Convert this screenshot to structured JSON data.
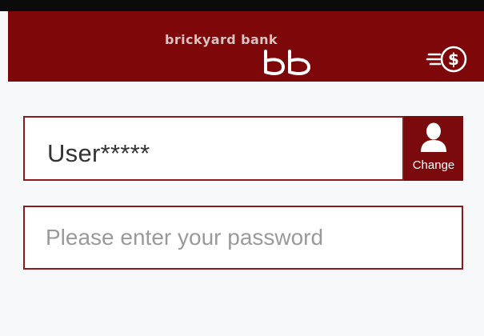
{
  "app": {
    "brand_name": "brickyard bank"
  },
  "header": {
    "logo_text": "brickyard bank",
    "logo_icon": "bb-logo-icon",
    "menu_icon": "money-menu-icon"
  },
  "login": {
    "username": "User*****",
    "change_label": "Change",
    "change_icon": "user-icon",
    "password_placeholder": "Please enter your password",
    "password_value": ""
  },
  "colors": {
    "header_bg": "#7d0709",
    "accent": "#7a0a0c",
    "border": "#8b1a1c",
    "page_bg": "#f7f8fa",
    "status_bar": "#0b0b0b"
  }
}
